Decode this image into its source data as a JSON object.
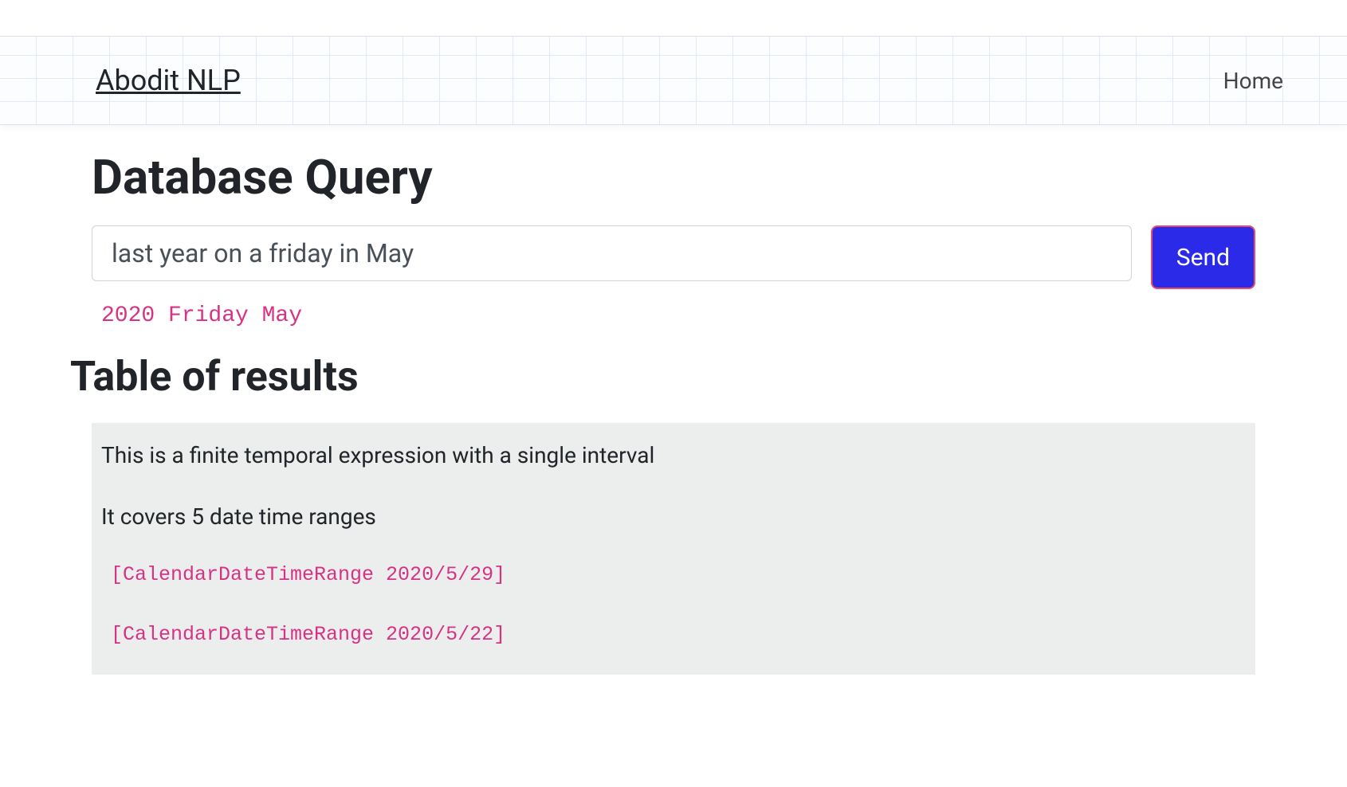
{
  "header": {
    "brand": "Abodit NLP",
    "nav": {
      "home": "Home"
    }
  },
  "main": {
    "title": "Database Query",
    "query_value": "last year on a friday in May",
    "send_label": "Send",
    "parsed": "2020 Friday May",
    "results_title": "Table of results",
    "results": {
      "description": "This is a finite temporal expression with a single interval",
      "coverage": "It covers 5 date time ranges",
      "ranges": [
        "[CalendarDateTimeRange 2020/5/29]",
        "[CalendarDateTimeRange 2020/5/22]"
      ]
    }
  }
}
